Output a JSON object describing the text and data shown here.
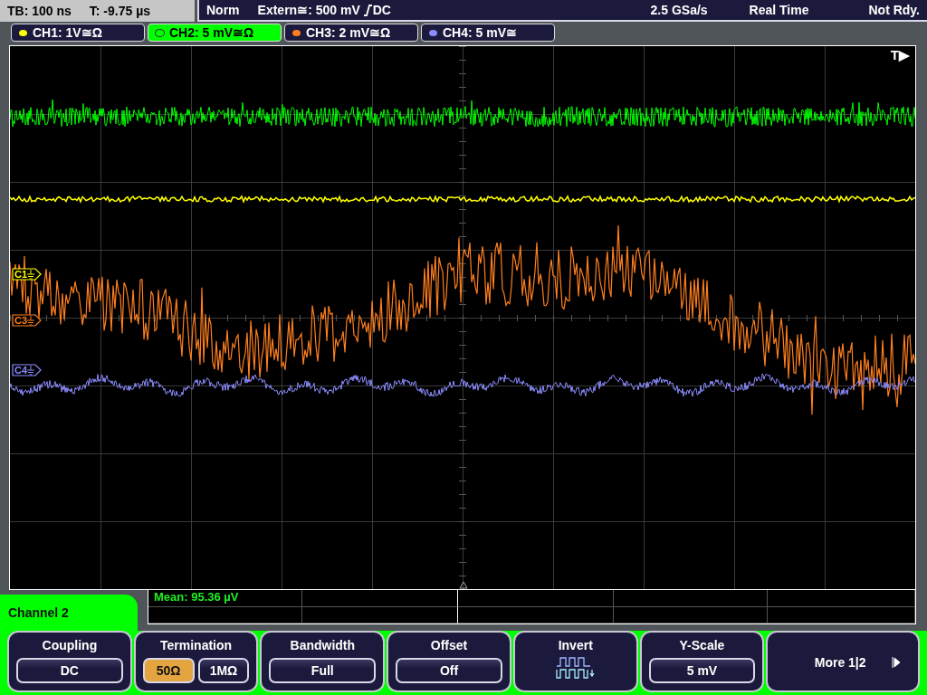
{
  "status_bar": {
    "timebase": "TB: 100 ns",
    "trigger_time": "T: -9.75 µs",
    "trigger_mode": "Norm",
    "trigger_source": "Extern≅: 500 mV",
    "trigger_coupling": "DC",
    "sample_rate": "2.5 GSa/s",
    "acquisition": "Real Time",
    "state": "Not Rdy."
  },
  "channel_tabs": [
    {
      "label": "CH1: 1V≅Ω",
      "color": "#ffff00",
      "selected": false
    },
    {
      "label": "CH2: 5 mV≅Ω",
      "color": "#00ff00",
      "selected": true
    },
    {
      "label": "CH3: 2 mV≅Ω",
      "color": "#ff7f1e",
      "selected": false
    },
    {
      "label": "CH4: 5 mV≅",
      "color": "#8c8cff",
      "selected": false
    }
  ],
  "graticule": {
    "trigger_marker": "T▶",
    "channel_markers": [
      {
        "label": "C1",
        "color": "#ffff00"
      },
      {
        "label": "C3",
        "color": "#ff7f1e"
      },
      {
        "label": "C4",
        "color": "#8c8cff"
      }
    ]
  },
  "measurement": "Mean: 95.36 µV",
  "menu": {
    "title": "Channel 2",
    "softkeys": [
      {
        "kind": "value",
        "label": "Coupling",
        "value": "DC"
      },
      {
        "kind": "options",
        "label": "Termination",
        "options": [
          {
            "label": "50Ω",
            "selected": true
          },
          {
            "label": "1MΩ",
            "selected": false
          }
        ]
      },
      {
        "kind": "value",
        "label": "Bandwidth",
        "value": "Full"
      },
      {
        "kind": "value",
        "label": "Offset",
        "value": "Off"
      },
      {
        "kind": "icon",
        "label": "Invert"
      },
      {
        "kind": "value",
        "label": "Y-Scale",
        "value": "5 mV"
      },
      {
        "kind": "more",
        "label": "More 1|2"
      }
    ]
  }
}
